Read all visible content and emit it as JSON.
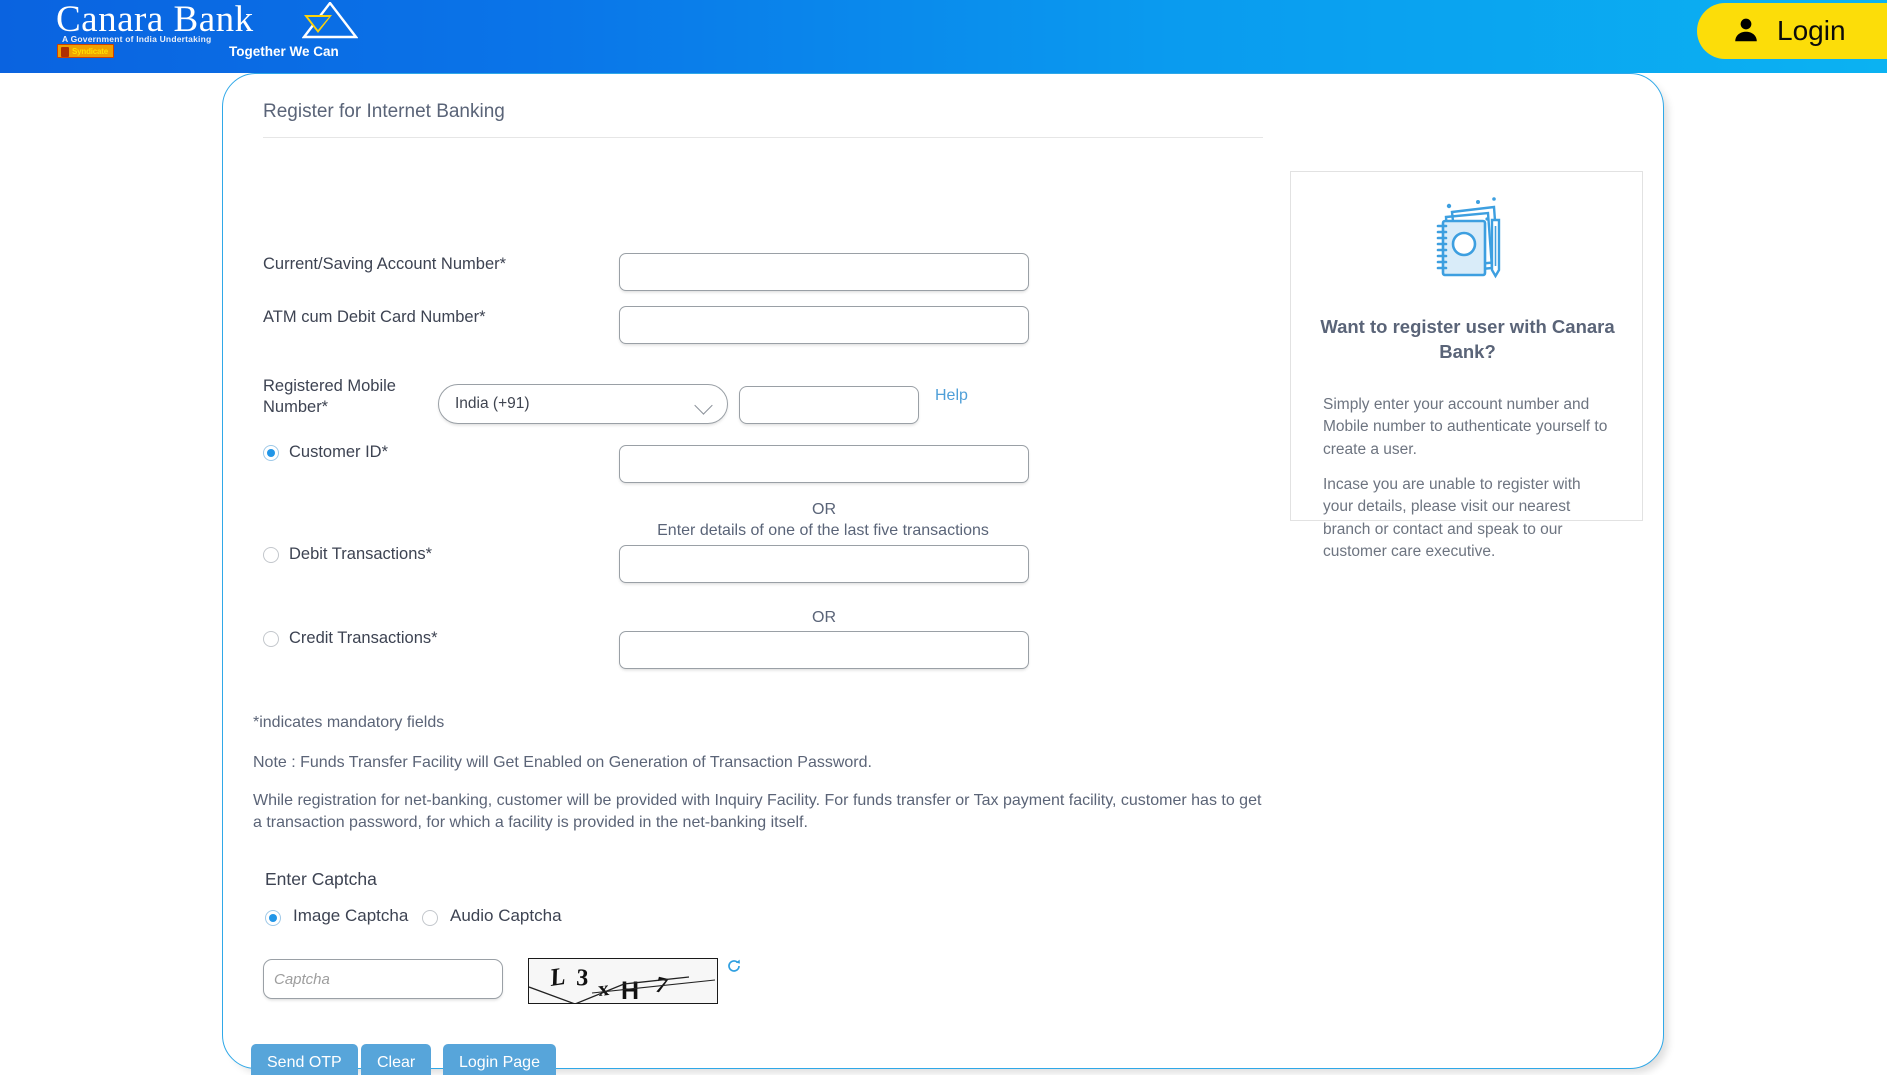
{
  "header": {
    "brand_name": "Canara Bank",
    "brand_tagline": "A Government of India Undertaking",
    "brand_motto": "Together We Can",
    "syndicate_badge": "Syndicate",
    "login_label": "Login",
    "login_icon": "person-icon",
    "gradient_from": "#0a63e0",
    "gradient_to": "#0bb2f2",
    "login_bg": "#fcdd09"
  },
  "form": {
    "title": "Register for Internet Banking",
    "fields": {
      "account_number": {
        "label": "Current/Saving Account Number*",
        "value": "",
        "placeholder": ""
      },
      "debit_card_number": {
        "label": "ATM cum Debit Card Number*",
        "value": "",
        "placeholder": ""
      },
      "mobile_number": {
        "label": "Registered Mobile Number*",
        "value": "",
        "placeholder": ""
      },
      "customer_id": {
        "label": "Customer ID*",
        "value": "",
        "placeholder": ""
      },
      "debit_transactions": {
        "label": "Debit Transactions*",
        "value": "",
        "placeholder": ""
      },
      "credit_transactions": {
        "label": "Credit Transactions*",
        "value": "",
        "placeholder": ""
      }
    },
    "country_code": {
      "selected": "India (+91)",
      "options": [
        "India (+91)"
      ]
    },
    "help_link": "Help",
    "or_1": "OR",
    "or_1_sub": "Enter details of one of the last five transactions",
    "or_2": "OR",
    "radio_selected": "customer_id",
    "mandatory_note": "*indicates mandatory fields",
    "note_line": "Note : Funds Transfer Facility will Get Enabled on Generation of Transaction Password.",
    "info_paragraph": "While registration for net-banking, customer will be provided with Inquiry Facility. For funds transfer or Tax payment facility, customer has to get a transaction password, for which a facility is provided in the net-banking itself."
  },
  "captcha": {
    "heading": "Enter Captcha",
    "option_image": "Image Captcha",
    "option_audio": "Audio Captcha",
    "selected_option": "image",
    "input_value": "",
    "input_placeholder": "Captcha",
    "challenge_text": "L3xH7",
    "refresh_icon": "refresh-icon"
  },
  "buttons": {
    "send_otp": "Send OTP",
    "clear": "Clear",
    "login_page": "Login Page",
    "color": "#57a5da"
  },
  "side_panel": {
    "icon": "notebook-pencil-icon",
    "title": "Want to register user with Canara Bank?",
    "para_1": "Simply enter your account number and Mobile number to authenticate yourself to create a user.",
    "para_2": "Incase you are unable to register with your details, please visit our nearest branch or contact and speak to our customer care executive."
  }
}
